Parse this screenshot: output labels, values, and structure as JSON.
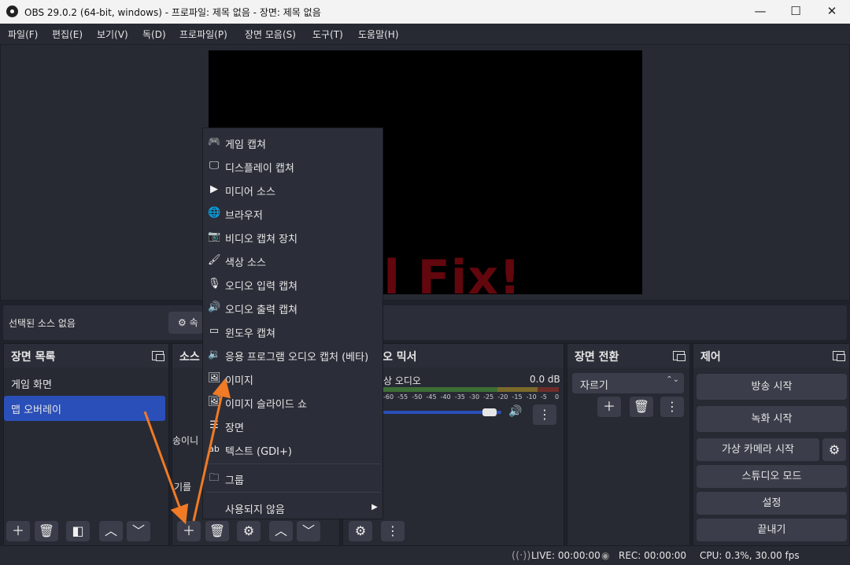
{
  "window": {
    "title": "OBS 29.0.2 (64-bit, windows) - 프로파일: 제목 없음 - 장면: 제목 없음",
    "minimize": "—",
    "maximize": "☐",
    "close": "✕"
  },
  "menu": [
    "파일(F)",
    "편집(E)",
    "보기(V)",
    "독(D)",
    "프로파일(P)",
    "장면 모음(S)",
    "도구(T)",
    "도움말(H)"
  ],
  "watermark": "Total Fix!",
  "source_bar": {
    "label": "선택된 소스 없음",
    "properties_partial": "속"
  },
  "scenes": {
    "title": "장면 목록",
    "items": [
      "게임 화면",
      "맵 오버레이"
    ],
    "selected_index": 1
  },
  "sources": {
    "title_partial": "소스",
    "hint_line1_partial": "송이니",
    "hint_line2_partial": "기를"
  },
  "mixer": {
    "title_partial": "오 믹서",
    "track_partial": "상 오디오",
    "level": "0.0 dB",
    "scale": [
      "-60",
      "-55",
      "-50",
      "-45",
      "-40",
      "-35",
      "-30",
      "-25",
      "-20",
      "-15",
      "-10",
      "-5",
      "0"
    ],
    "volume_fraction": 0.96
  },
  "transitions": {
    "title": "장면 전환",
    "selected": "자르기"
  },
  "controls": {
    "title": "제어",
    "buttons": [
      "방송 시작",
      "녹화 시작",
      "가상 카메라 시작",
      "스튜디오 모드",
      "설정",
      "끝내기"
    ]
  },
  "context_menu": {
    "items": [
      {
        "label": "게임 캡쳐",
        "icon": "gamepad-icon",
        "glyph": "🎮"
      },
      {
        "label": "디스플레이 캡쳐",
        "icon": "monitor-icon",
        "glyph": "🖵"
      },
      {
        "label": "미디어 소스",
        "icon": "play-icon",
        "glyph": "▶"
      },
      {
        "label": "브라우저",
        "icon": "globe-icon",
        "glyph": "🌐"
      },
      {
        "label": "비디오 캡쳐 장치",
        "icon": "camera-icon",
        "glyph": "📷"
      },
      {
        "label": "색상 소스",
        "icon": "brush-icon",
        "glyph": "🖌"
      },
      {
        "label": "오디오 입력 캡쳐",
        "icon": "microphone-icon",
        "glyph": "🎙"
      },
      {
        "label": "오디오 출력 캡쳐",
        "icon": "speaker-icon",
        "glyph": "🔊"
      },
      {
        "label": "윈도우 캡쳐",
        "icon": "window-icon",
        "glyph": "▭"
      },
      {
        "label": "응용 프로그램 오디오 캡처 (베타)",
        "icon": "app-audio-icon",
        "glyph": "🔉"
      },
      {
        "label": "이미지",
        "icon": "image-icon",
        "glyph": "🖼"
      },
      {
        "label": "이미지 슬라이드 쇼",
        "icon": "slideshow-icon",
        "glyph": "🖼"
      },
      {
        "label": "장면",
        "icon": "list-icon",
        "glyph": "☰"
      },
      {
        "label": "텍스트 (GDI+)",
        "icon": "text-icon",
        "glyph": "ab"
      },
      {
        "label": "그룹",
        "icon": "folder-icon",
        "glyph": "🗀"
      },
      {
        "label": "사용되지 않음",
        "icon": "submenu-arrow-icon",
        "glyph": "▶"
      }
    ]
  },
  "status": {
    "live": "LIVE: 00:00:00",
    "rec": "REC: 00:00:00",
    "cpu": "CPU: 0.3%, 30.00 fps"
  },
  "colors": {
    "accent": "#2a4fb9",
    "arrow": "#f07a25",
    "meter_green": "#4caf3c",
    "meter_yellow": "#c8a92a",
    "meter_red": "#c0392b"
  }
}
